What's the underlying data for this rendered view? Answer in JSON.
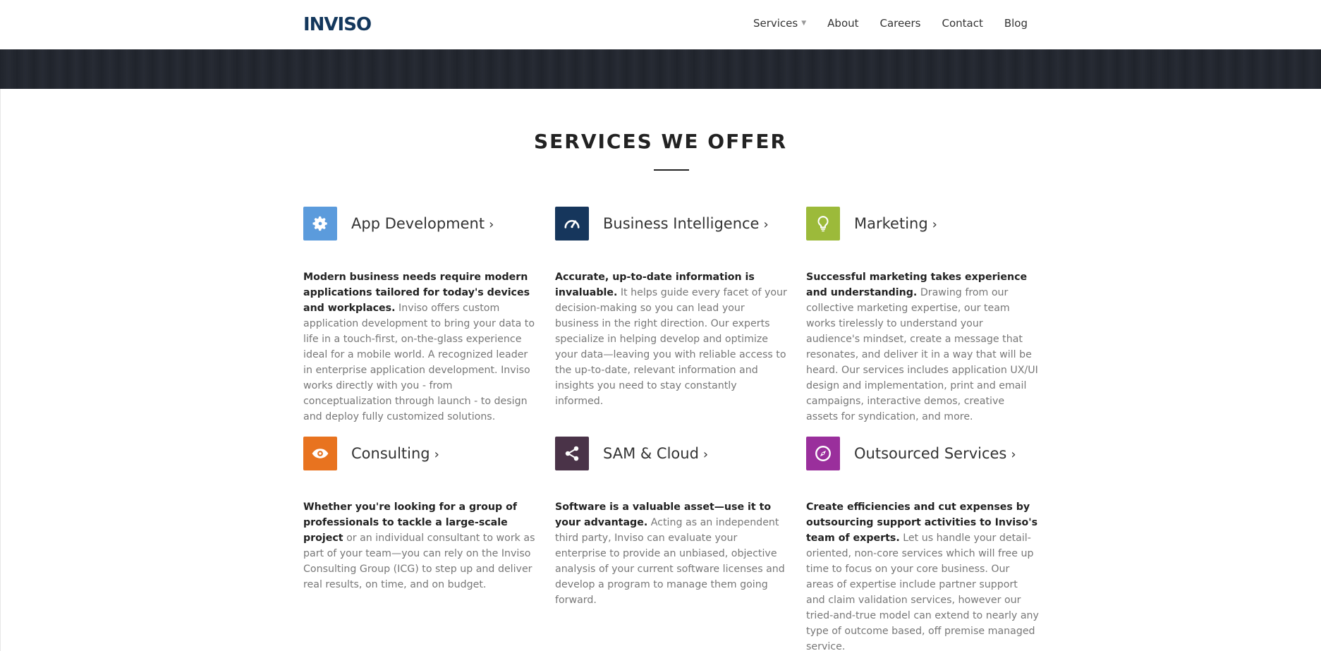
{
  "header": {
    "logo": "INVISO",
    "nav": [
      {
        "label": "Services",
        "has_caret": true
      },
      {
        "label": "About"
      },
      {
        "label": "Careers"
      },
      {
        "label": "Contact"
      },
      {
        "label": "Blog"
      }
    ]
  },
  "section": {
    "title": "SERVICES WE OFFER"
  },
  "services": [
    {
      "title": "App Development",
      "icon": "gear-icon",
      "color": "#5b9bdc",
      "lead": "Modern business needs require modern applications tailored for today's devices and workplaces.",
      "body": " Inviso offers custom application development to bring your data to life in a touch-first, on-the-glass experience ideal for a mobile world. A recognized leader in enterprise application development. Inviso works directly with you - from conceptualization through launch - to design and deploy fully customized solutions."
    },
    {
      "title": "Business Intelligence",
      "icon": "dashboard-icon",
      "color": "#16365c",
      "lead": "Accurate, up-to-date information is invaluable.",
      "body": " It helps guide every facet of your decision-making so you can lead your business in the right direction. Our experts specialize in helping develop and optimize your data—leaving you with reliable access to the up-to-date, relevant information and insights you need to stay constantly informed."
    },
    {
      "title": "Marketing",
      "icon": "lightbulb-icon",
      "color": "#9cba3a",
      "lead": "Successful marketing takes experience and understanding.",
      "body": " Drawing from our collective marketing expertise, our team works tirelessly to understand your audience's mindset, create a message that resonates, and deliver it in a way that will be heard. Our services includes application UX/UI design and implementation, print and email campaigns, interactive demos, creative assets for syndication, and more."
    },
    {
      "title": "Consulting",
      "icon": "eye-icon",
      "color": "#e8731f",
      "lead": "Whether you're looking for a group of professionals to tackle a large-scale project",
      "body": " or an individual consultant to work as part of your team—you can rely on the Inviso Consulting Group (ICG) to step up and deliver real results, on time, and on budget."
    },
    {
      "title": "SAM & Cloud",
      "icon": "share-icon",
      "color": "#4a3348",
      "lead": "Software is a valuable asset—use it to your advantage.",
      "body": " Acting as an independent third party, Inviso can evaluate your enterprise to provide an unbiased, objective analysis of your current software licenses and develop a program to manage them going forward."
    },
    {
      "title": "Outsourced Services",
      "icon": "compass-icon",
      "color": "#9a2f9c",
      "lead": "Create efficiencies and cut expenses by outsourcing support activities to Inviso's team of experts.",
      "body": " Let us handle your detail-oriented, non-core services which will free up time to focus on your core business. Our areas of expertise include partner support and claim validation services, however our tried-and-true model can extend to nearly any type of outcome based, off premise managed service."
    }
  ]
}
